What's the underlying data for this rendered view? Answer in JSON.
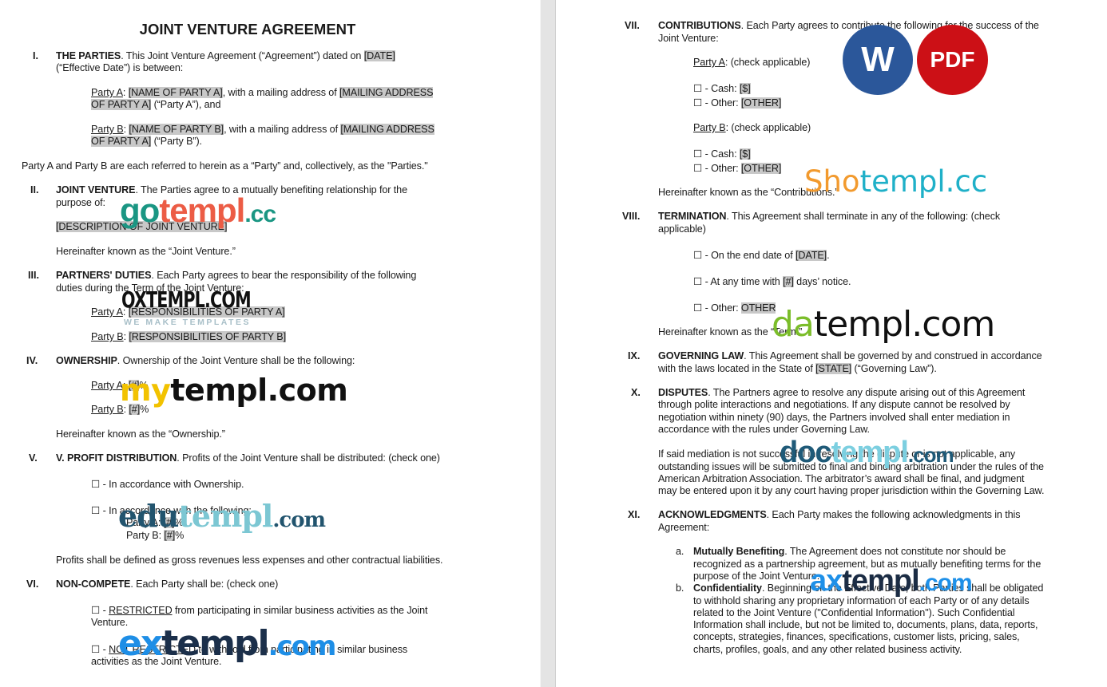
{
  "document": {
    "title": "JOINT VENTURE AGREEMENT",
    "sections": {
      "s1": {
        "num": "I.",
        "heading": "THE PARTIES",
        "line1": ". This Joint Venture Agreement (“Agreement”) dated on ",
        "date_field": "[DATE]",
        "line2": "(“Effective Date”) is between:",
        "party_a_label": "Party A",
        "party_a_name": "[NAME OF PARTY A]",
        "party_a_mid": ", with a mailing address of ",
        "party_a_addr1": "[MAILING ADDRESS ",
        "party_a_addr2": "OF PARTY A]",
        "party_a_end": " (“Party A”), and",
        "party_b_label": "Party B",
        "party_b_name": "[NAME OF PARTY B]",
        "party_b_mid": ", with a mailing address of ",
        "party_b_addr1": "[MAILING ADDRESS ",
        "party_b_addr2": "OF PARTY A]",
        "party_b_end": " (“Party B”).",
        "collective": "Party A and Party B are each referred to herein as a “Party” and, collectively, as the \"Parties.\""
      },
      "s2": {
        "num": "II.",
        "heading": "JOINT VENTURE",
        "line1": ". The Parties agree to a mutually benefiting relationship for the",
        "line2": "purpose of:",
        "description_field": "[DESCRIPTION OF JOINT VENTURE]",
        "hereinafter": "Hereinafter known as the “Joint Venture.”"
      },
      "s3": {
        "num": "III.",
        "heading": "PARTNERS' DUTIES",
        "line1": ". Each Party agrees to bear the responsibility of the following",
        "line2": "duties during the Term of the Joint Venture:",
        "party_a_label": "Party A",
        "party_a_field": "[RESPONSIBILITIES OF PARTY A]",
        "party_b_label": "Party B",
        "party_b_field": "[RESPONSIBILITIES OF PARTY B]"
      },
      "s4": {
        "num": "IV.",
        "heading": "OWNERSHIP",
        "line1": ". Ownership of the Joint Venture shall be the following:",
        "party_a_label": "Party A",
        "party_a_field": "[#]",
        "party_b_label": "Party B",
        "party_b_field": "[#]",
        "percent": "%",
        "hereinafter": "Hereinafter known as the “Ownership.”"
      },
      "s5": {
        "num": "V.",
        "heading": "V. PROFIT DISTRIBUTION",
        "line1": ". Profits of the Joint Venture shall be distributed: (check one)",
        "option1": "☐ - In accordance with Ownership.",
        "option2": "☐ - In accordance with the following:",
        "party_a_text": "Party A: ",
        "party_a_field": "[#]",
        "party_b_text": "Party B: ",
        "party_b_field": "[#]",
        "percent": "%",
        "definition": "Profits shall be defined as gross revenues less expenses and other contractual liabilities."
      },
      "s6": {
        "num": "VI.",
        "heading": "NON-COMPETE",
        "line1": ". Each Party shall be: (check one)",
        "opt1_box": "☐ - ",
        "opt1_key": "RESTRICTED",
        "opt1_rest": " from participating in similar business activities as the Joint",
        "opt1_line2": "Venture.",
        "opt2_box": "☐ - ",
        "opt2_key": "NOT RESTRICTED",
        "opt2_rest": " to withhold from participating in similar business",
        "opt2_line2": "activities as the Joint Venture."
      },
      "s7": {
        "num": "VII.",
        "heading": "CONTRIBUTIONS",
        "line1": ". Each Party agrees to contribute the following for the success of the",
        "line2": "Joint Venture:",
        "party_a_label": "Party A",
        "party_b_label": "Party B",
        "check_applicable": ": (check applicable)",
        "cash_text": "☐ - Cash: ",
        "cash_field": "[$]",
        "other_text": "☐ - Other: ",
        "other_field": "[OTHER]",
        "hereinafter": "Hereinafter known as the “Contributions.”"
      },
      "s8": {
        "num": "VIII.",
        "heading": "TERMINATION",
        "line1": ". This Agreement shall terminate in any of the following: (check",
        "line2": "applicable)",
        "opt1_text": "☐ - On the end date of ",
        "opt1_field": "[DATE]",
        "opt1_end": ".",
        "opt2_text": "☐ - At any time with ",
        "opt2_field": "[#]",
        "opt2_end": " days’ notice.",
        "opt3_text": "☐ - Other: ",
        "opt3_field": "OTHER",
        "hereinafter": "Hereinafter known as the “Term.”"
      },
      "s9": {
        "num": "IX.",
        "heading": "GOVERNING LAW",
        "line1": ". This Agreement shall be governed by and construed in accordance",
        "line2_a": "with the laws located in the State of ",
        "state_field": "[STATE]",
        "line2_b": " (“Governing Law”)."
      },
      "s10": {
        "num": "X.",
        "heading": "DISPUTES",
        "line1": ". The Partners agree to resolve any dispute arising out of this Agreement",
        "line2": "through polite interactions and negotiations. If any dispute cannot be resolved by",
        "line3": "negotiation within ninety (90) days, the Partners involved shall enter mediation in",
        "line4": "accordance with the rules under Governing Law.",
        "p2_line1": "If said mediation is not successful in resolving the dispute or is not applicable, any",
        "p2_line2": "outstanding issues will be submitted to final and binding arbitration under the rules of the",
        "p2_line3": "American Arbitration Association. The arbitrator’s award shall be final, and judgment",
        "p2_line4": "may be entered upon it by any court having proper jurisdiction within the Governing Law."
      },
      "s11": {
        "num": "XI.",
        "heading": "ACKNOWLEDGMENTS",
        "line1": ". Each Party makes the following acknowledgments in this",
        "line2": "Agreement:",
        "a_marker": "a.",
        "a_heading": "Mutually Benefiting",
        "a_line1": ". The Agreement does not constitute nor should be",
        "a_line2": "recognized as a partnership agreement, but as mutually benefiting terms for the",
        "a_line3": "purpose of the Joint Venture.",
        "b_marker": "b.",
        "b_heading": "Confidentiality",
        "b_line1": ". Beginning on the Effective Date, both Parties shall be obligated",
        "b_line2": "to withhold sharing any proprietary information of each Party or of any details",
        "b_line3": "related to the Joint Venture (\"Confidential Information\"). Such Confidential",
        "b_line4": "Information shall include, but not be limited to, documents, plans, data, reports,",
        "b_line5": "concepts, strategies, finances, specifications, customer lists, pricing, sales,",
        "b_line6": "charts, profiles, goals, and any other related business activity."
      }
    }
  },
  "badges": {
    "word": {
      "label": "W",
      "color": "#2b579a"
    },
    "pdf": {
      "label": "PDF",
      "color": "#cc1016"
    }
  },
  "watermarks": {
    "gotempl": {
      "a": "go",
      "b": "templ",
      "c": ".cc"
    },
    "oxtempl": {
      "main": "OXTEMPL.COM",
      "sub": "WE MAKE TEMPLATES"
    },
    "mytempl": {
      "a": "my",
      "b": "templ.com"
    },
    "edutempl": {
      "a": "edu",
      "b": "templ",
      "c": ".com"
    },
    "extempl": {
      "a": "ex",
      "b": "templ",
      "c": ".com"
    },
    "shotempl": {
      "a": "Sho",
      "b": "templ.cc"
    },
    "datempl": {
      "a": "da",
      "b": "templ.com"
    },
    "doctempl": {
      "a": "doc",
      "b": "templ",
      "c": ".com"
    },
    "axtempl": {
      "a": "ax",
      "b": "templ",
      "c": ".com"
    }
  }
}
